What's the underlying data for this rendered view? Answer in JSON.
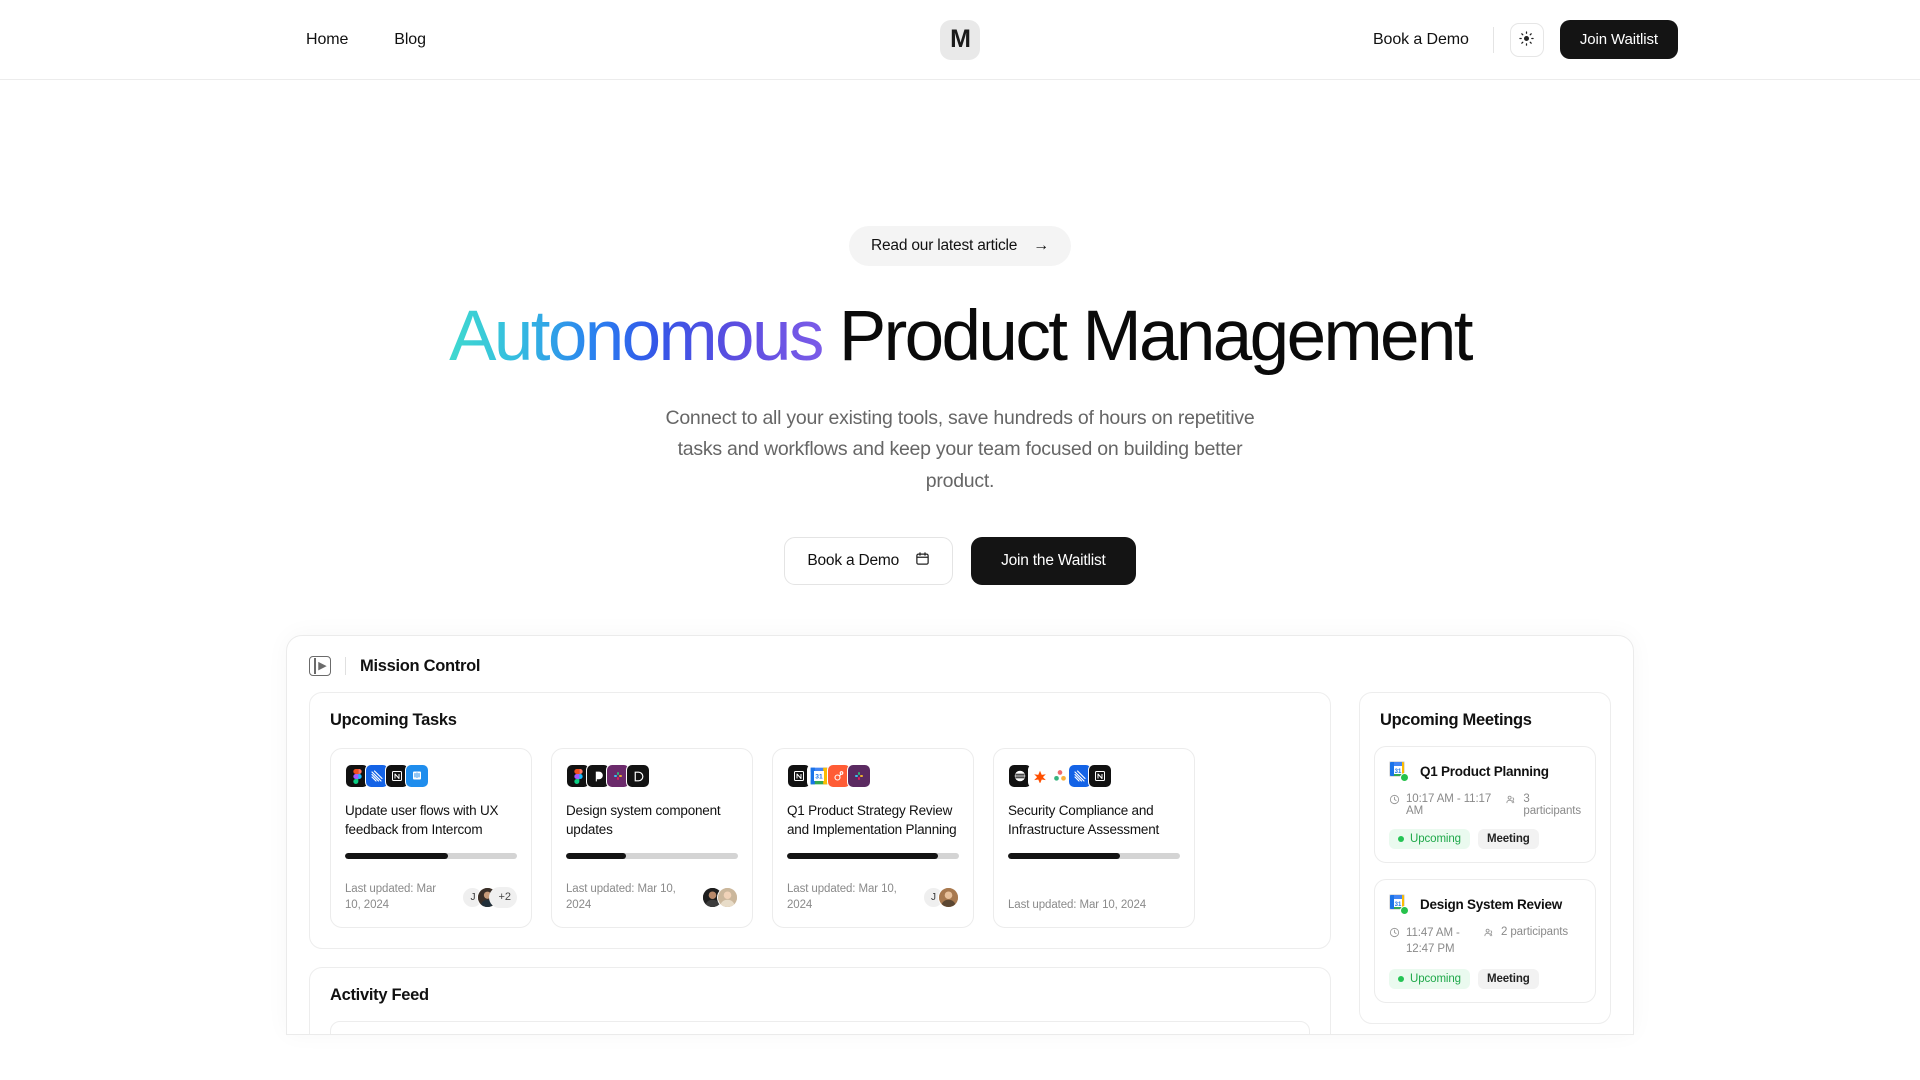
{
  "header": {
    "nav_links": [
      {
        "label": "Home"
      },
      {
        "label": "Blog"
      }
    ],
    "logo_text": "M",
    "book_demo_label": "Book a Demo",
    "theme_icon": "sun-icon",
    "join_waitlist_label": "Join Waitlist"
  },
  "hero": {
    "badge_label": "Read our latest article",
    "badge_arrow": "→",
    "headline_gradient": "Autonomous",
    "headline_rest": " Product Management",
    "subtitle": "Connect to all your existing tools, save hundreds of hours on repetitive tasks and workflows and keep your team focused on building better product.",
    "cta_primary": "Join the Waitlist",
    "cta_secondary": "Book a Demo",
    "cta_secondary_icon": "calendar-icon",
    "gradient_colors": [
      "#3fd9cf",
      "#35bde0",
      "#2a7ef0",
      "#3457e8",
      "#5b4de0",
      "#7b5be8"
    ]
  },
  "panel": {
    "toggle_icon": "sidebar-toggle-icon",
    "title": "Mission Control",
    "tasks_section_title": "Upcoming Tasks",
    "activity_section_title": "Activity Feed",
    "meetings_section_title": "Upcoming Meetings",
    "tasks": [
      {
        "title": "Update user flows with UX feedback from Intercom",
        "progress": 60,
        "updated": "Last updated: Mar 10, 2024",
        "apps": [
          "figma",
          "linear",
          "notion",
          "intercom"
        ],
        "avatars": [
          "J",
          "photo"
        ],
        "extra_avatars": "+2"
      },
      {
        "title": "Design system component updates",
        "progress": 35,
        "updated": "Last updated: Mar 10, 2024",
        "apps": [
          "figma",
          "github",
          "slack",
          "vercel"
        ],
        "avatars": [
          "photo",
          "photo"
        ],
        "extra_avatars": ""
      },
      {
        "title": "Q1 Product Strategy Review and Implementation Planning",
        "progress": 88,
        "updated": "Last updated: Mar 10, 2024",
        "apps": [
          "notion",
          "gcal",
          "hubspot",
          "slack"
        ],
        "avatars": [
          "J",
          "photo"
        ],
        "extra_avatars": ""
      },
      {
        "title": "Security Compliance and Infrastructure Assessment",
        "progress": 65,
        "updated": "Last updated: Mar 10, 2024",
        "apps": [
          "vanta",
          "zapier",
          "asana",
          "linear",
          "notion"
        ],
        "avatars": [],
        "extra_avatars": ""
      }
    ],
    "meetings": [
      {
        "title": "Q1 Product Planning",
        "icon": "google-calendar-icon",
        "time": "10:17 AM - 11:17 AM",
        "participants": "3 participants",
        "status_tag": "Upcoming",
        "type_tag": "Meeting"
      },
      {
        "title": "Design System Review",
        "icon": "google-calendar-icon",
        "time": "11:47 AM - 12:47 PM",
        "participants": "2 participants",
        "status_tag": "Upcoming",
        "type_tag": "Meeting"
      }
    ]
  },
  "colors": {
    "dark": "#141414",
    "green": "#25c455",
    "muted": "#8a8a8a"
  }
}
